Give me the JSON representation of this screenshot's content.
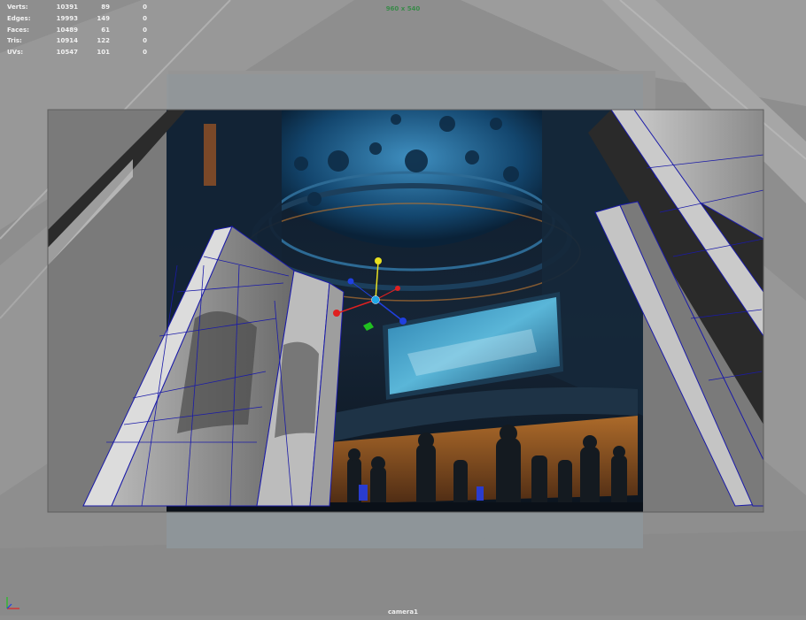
{
  "hud": {
    "rows": [
      {
        "label": "Verts:",
        "total": "10391",
        "selected": "89",
        "extra": "0"
      },
      {
        "label": "Edges:",
        "total": "19993",
        "selected": "149",
        "extra": "0"
      },
      {
        "label": "Faces:",
        "total": "10489",
        "selected": "61",
        "extra": "0"
      },
      {
        "label": "Tris:",
        "total": "10914",
        "selected": "122",
        "extra": "0"
      },
      {
        "label": "UVs:",
        "total": "10547",
        "selected": "101",
        "extra": "0"
      }
    ]
  },
  "viewport": {
    "resolution_label": "960 x 540",
    "camera_label": "camera1"
  },
  "colors": {
    "background": "#8e8e8e",
    "wireframe": "#1a1aa8",
    "gate_mask": "#7a7a7a",
    "resolution_text": "#3a8a4a",
    "manip_x": "#e02020",
    "manip_y": "#e8e020",
    "manip_z": "#2040e0",
    "manip_center": "#20a8e8",
    "manip_plane_green": "#20c020"
  },
  "icons": {
    "axis": "xyz-axis-icon",
    "manipulator": "move-manipulator-icon"
  }
}
